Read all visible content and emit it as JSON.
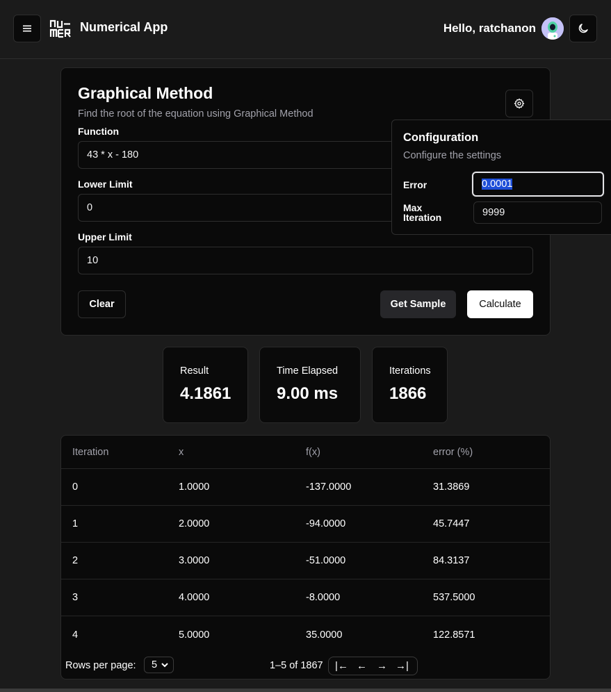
{
  "header": {
    "app_title": "Numerical App",
    "logo_text": "NUMER",
    "greeting": "Hello, ratchanon",
    "icons": {
      "menu": "hamburger-icon",
      "theme": "moon-icon",
      "avatar": "robot-avatar"
    }
  },
  "card": {
    "title": "Graphical Method",
    "subtitle": "Find the root of the equation using Graphical Method",
    "function_label": "Function",
    "function_value": "43 * x - 180",
    "lower_label": "Lower Limit",
    "lower_value": "0",
    "upper_label": "Upper Limit",
    "upper_value": "10",
    "clear_label": "Clear",
    "sample_label": "Get Sample",
    "calculate_label": "Calculate"
  },
  "config": {
    "title": "Configuration",
    "subtitle": "Configure the settings",
    "error_label": "Error",
    "error_value": "0.0001",
    "max_label_1": "Max",
    "max_label_2": "Iteration",
    "max_value": "9999"
  },
  "stats": [
    {
      "label": "Result",
      "value": "4.1861"
    },
    {
      "label": "Time Elapsed",
      "value": "9.00 ms"
    },
    {
      "label": "Iterations",
      "value": "1866"
    }
  ],
  "table": {
    "headers": [
      "Iteration",
      "x",
      "f(x)",
      "error (%)"
    ],
    "rows": [
      [
        "0",
        "1.0000",
        "-137.0000",
        "31.3869"
      ],
      [
        "1",
        "2.0000",
        "-94.0000",
        "45.7447"
      ],
      [
        "2",
        "3.0000",
        "-51.0000",
        "84.3137"
      ],
      [
        "3",
        "4.0000",
        "-8.0000",
        "537.5000"
      ],
      [
        "4",
        "5.0000",
        "35.0000",
        "122.8571"
      ]
    ],
    "rows_per_page_label": "Rows per page:",
    "rows_per_page_value": "5",
    "page_info": "1–5 of 1867",
    "pager": [
      "|←",
      "←",
      "→",
      "→|"
    ]
  },
  "colors": {
    "background": "#1b1b1b",
    "card": "#0a0a0a",
    "border": "#2e2e2e",
    "primary_button": "#ffffff",
    "secondary_button": "#27272a",
    "selection": "#1d4ed8"
  }
}
